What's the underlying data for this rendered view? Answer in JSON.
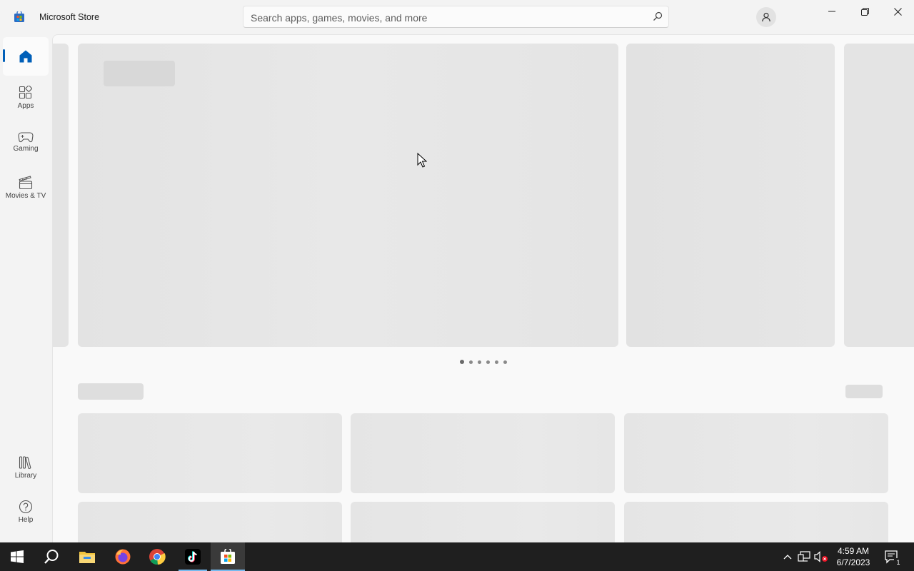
{
  "app": {
    "title": "Microsoft Store"
  },
  "search": {
    "placeholder": "Search apps, games, movies, and more"
  },
  "sidebar": {
    "items": [
      {
        "label": "",
        "icon": "home-icon",
        "selected": true
      },
      {
        "label": "Apps",
        "icon": "apps-icon"
      },
      {
        "label": "Gaming",
        "icon": "controller-icon"
      },
      {
        "label": "Movies & TV",
        "icon": "clapperboard-icon"
      }
    ],
    "bottom_items": [
      {
        "label": "Library",
        "icon": "library-icon"
      },
      {
        "label": "Help",
        "icon": "help-icon"
      }
    ]
  },
  "carousel": {
    "page_count": 6,
    "active_page": 1
  },
  "taskbar": {
    "apps": [
      "windows-start-icon",
      "search-icon",
      "file-explorer-icon",
      "firefox-icon",
      "chrome-icon",
      "tiktok-icon",
      "microsoft-store-icon"
    ],
    "time": "4:59 AM",
    "date": "6/7/2023",
    "notification_count": "1"
  },
  "colors": {
    "accent": "#005fb8",
    "taskbar": "#1f1f1f",
    "background": "#f3f3f3"
  }
}
